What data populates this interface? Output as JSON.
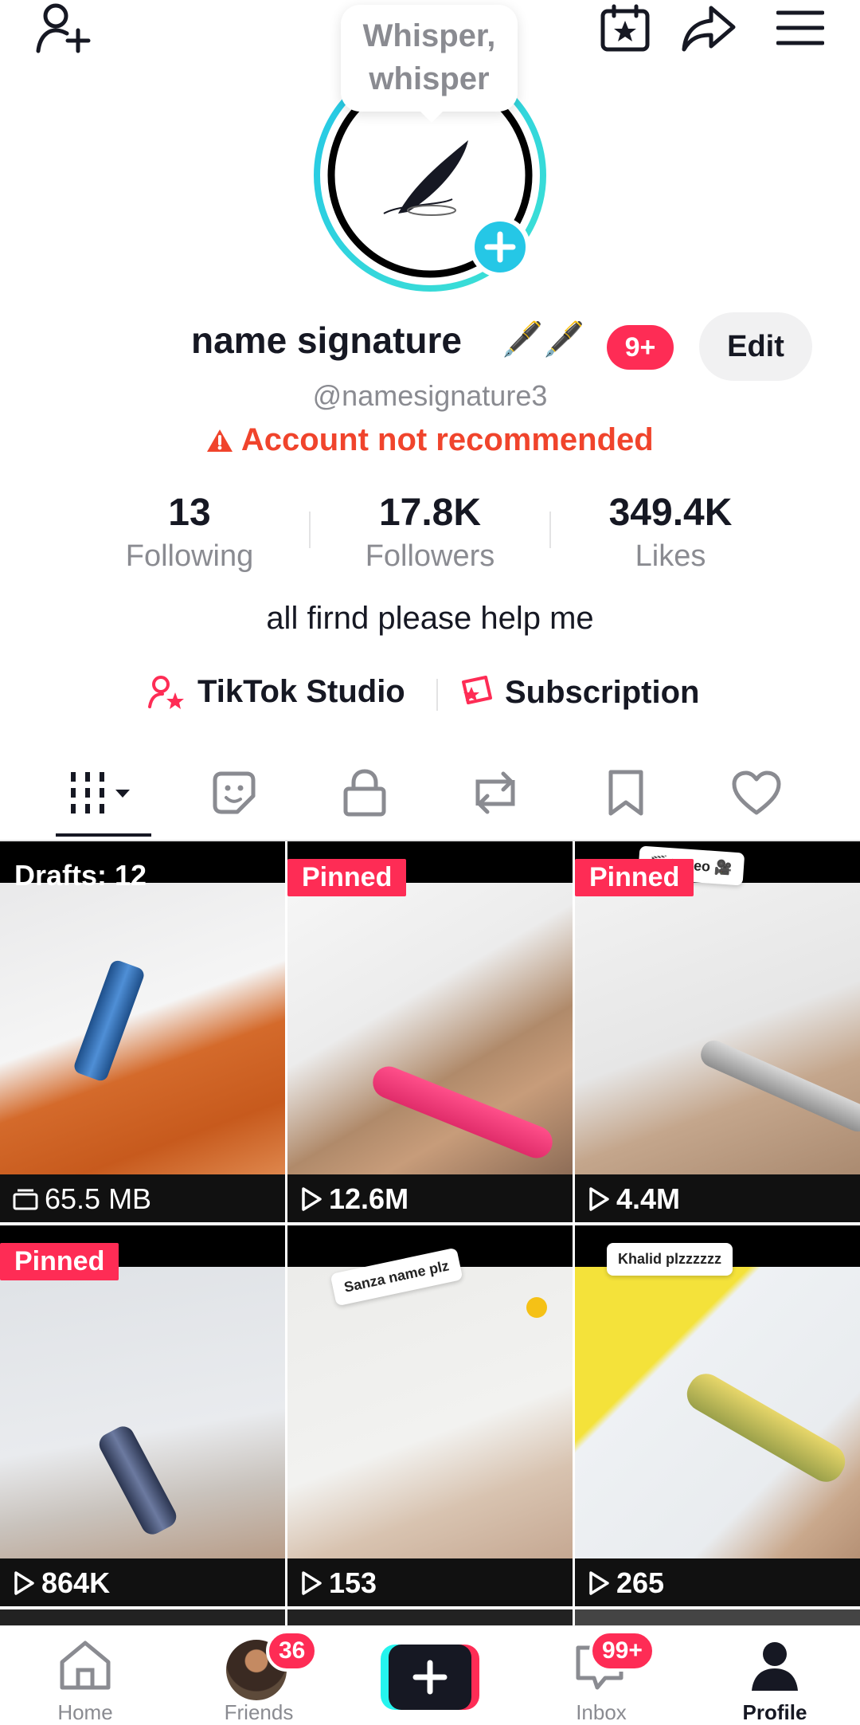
{
  "bubble": {
    "text": "Whisper, whisper"
  },
  "profile": {
    "name": "name signature",
    "emoji": "🖋️🖋️",
    "badge": "9+",
    "edit_label": "Edit",
    "handle": "@namesignature3",
    "warning": "Account not recommended",
    "bio": "all firnd please help me"
  },
  "stats": [
    {
      "value": "13",
      "label": "Following"
    },
    {
      "value": "17.8K",
      "label": "Followers"
    },
    {
      "value": "349.4K",
      "label": "Likes"
    }
  ],
  "links": {
    "studio": "TikTok Studio",
    "subscription": "Subscription"
  },
  "tabs": [
    "videos-grid-icon",
    "sticker-icon",
    "lock-icon",
    "repost-icon",
    "bookmark-icon",
    "heart-icon"
  ],
  "grid": [
    {
      "tag": "Drafts: 12",
      "count": "65.5 MB"
    },
    {
      "tag": "Pinned",
      "count": "12.6M"
    },
    {
      "tag": "Pinned",
      "count": "4.4M",
      "note": "🎬 Video 🎥"
    },
    {
      "tag": "Pinned",
      "count": "864K"
    },
    {
      "tag": "",
      "count": "153",
      "note": "Sanza name plz"
    },
    {
      "tag": "",
      "count": "265",
      "note": "Khalid plzzzzzz"
    }
  ],
  "nav": {
    "home": "Home",
    "friends": "Friends",
    "friends_badge": "36",
    "inbox": "Inbox",
    "inbox_badge": "99+",
    "profile": "Profile"
  },
  "colors": {
    "accent": "#fe2c55",
    "warning": "#f0442c",
    "cyan": "#25c7e6"
  }
}
